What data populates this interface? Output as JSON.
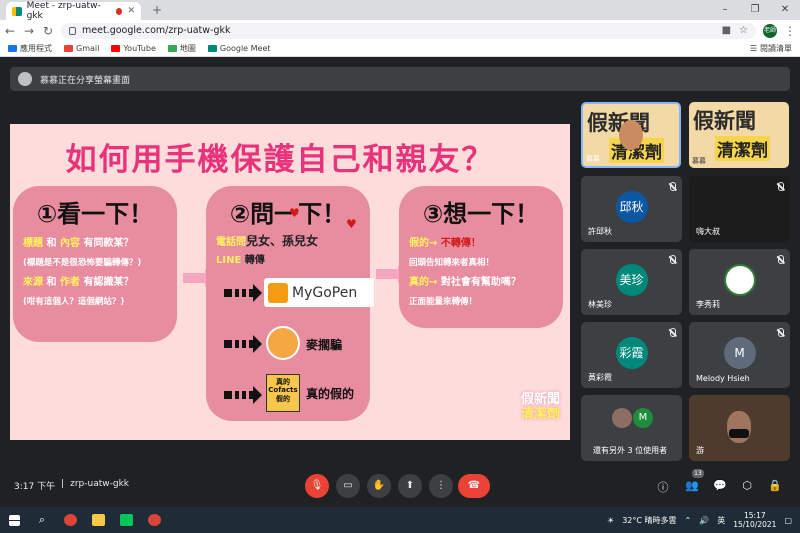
{
  "browser": {
    "tab_title": "Meet - zrp-uatw-gkk",
    "url": "meet.google.com/zrp-uatw-gkk",
    "profile_label": "老師",
    "bookmarks": [
      "應用程式",
      "Gmail",
      "YouTube",
      "地圖",
      "Google Meet"
    ],
    "reading_list": "閱讀清單"
  },
  "banner": {
    "text": "慕慕正在分享螢幕畫面"
  },
  "slide": {
    "title": "如何用手機保護自己和親友？",
    "card1": {
      "heading": "①看一下！",
      "l1a": "標題",
      "l1b": "和",
      "l1c": "內容",
      "l1d": "有同款某？",
      "l2": "(標題是不是很恐怖要騙轉傳？)",
      "l3a": "來源",
      "l3b": "和",
      "l3c": "作者",
      "l3d": "有認識某？",
      "l4": "(咁有這個人？這個網站？)"
    },
    "card2": {
      "heading": "②問一下！",
      "l1a": "電話問",
      "l1b": "兒女、孫兒女",
      "l2a": "LINE",
      "l2b": "轉傳",
      "mygopen": "MyGoPen",
      "mailibian": "麥擱騙",
      "cofacts_badge": "真的 Cofacts 假的",
      "cofacts": "真的假的"
    },
    "card3": {
      "heading": "③想一下！",
      "l1a": "假的→",
      "l1b": "不轉傳！",
      "l2": "回頭告知轉來者真相！",
      "l3a": "真的→",
      "l3b": "對社會有幫助嗎？",
      "l4": "正面能量來轉傳！"
    },
    "watermark_1": "假新聞",
    "watermark_2": "清潔劑"
  },
  "participants": {
    "thumb1_top": "假新聞",
    "thumb1_bottom": "清潔劑",
    "thumb1_name": "慕慕",
    "thumb2_top": "假新聞",
    "thumb2_bottom": "清潔劑",
    "thumb2_name": "慕慕",
    "tiles": [
      {
        "name": "許邱秋",
        "initials": "邱秋",
        "color": "#0b57a4"
      },
      {
        "name": "嗨大叔"
      },
      {
        "name": "林美珍",
        "initials": "美珍",
        "color": "#00897b"
      },
      {
        "name": "李秀莉"
      },
      {
        "name": "黃彩霞",
        "initials": "彩霞",
        "color": "#00897b"
      },
      {
        "name": "Melody Hsieh",
        "initials": "M",
        "color": "#5f6b7a"
      },
      {
        "name": "還有另外 3 位使用者",
        "initials": "M",
        "color": "#1e8e3e"
      },
      {
        "name": "游"
      }
    ]
  },
  "bottom": {
    "time": "3:17 下午",
    "separator": "|",
    "code": "zrp-uatw-gkk",
    "people_count": "13"
  },
  "taskbar": {
    "weather": "32°C 晴時多雲",
    "ime": "英",
    "time": "15:17",
    "date": "15/10/2021"
  }
}
